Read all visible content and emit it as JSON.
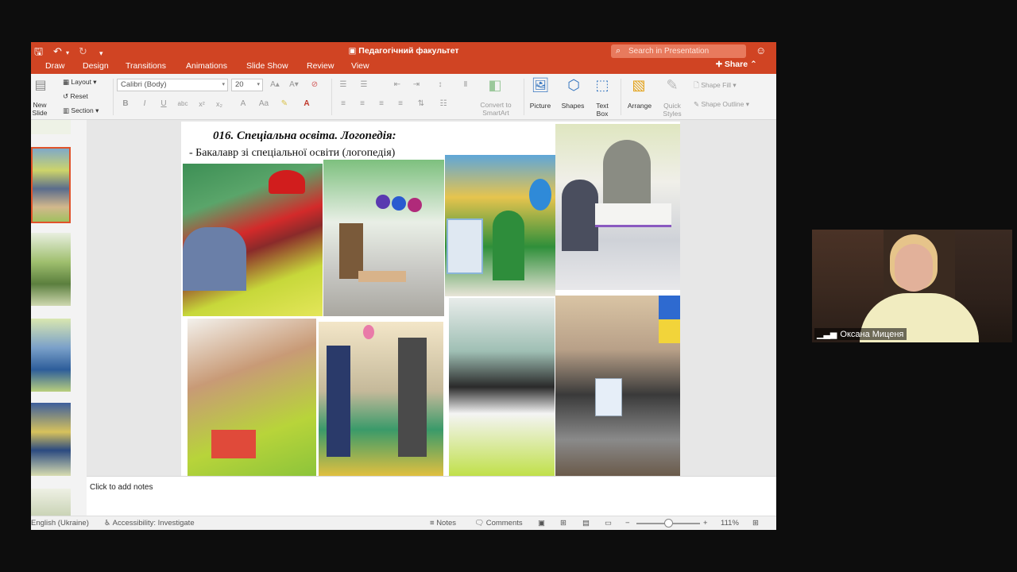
{
  "window": {
    "title": "Педагогічний факультет",
    "search_placeholder": "Search in Presentation",
    "share_label": "Share",
    "tabs": [
      "Draw",
      "Design",
      "Transitions",
      "Animations",
      "Slide Show",
      "Review",
      "View"
    ]
  },
  "ribbon": {
    "new_slide_label": "New\nSlide",
    "layout_label": "Layout",
    "reset_label": "Reset",
    "section_label": "Section",
    "font_name": "Calibri (Body)",
    "font_size": "20",
    "convert_smartart": "Convert to\nSmartArt",
    "picture_label": "Picture",
    "shapes_label": "Shapes",
    "textbox_label": "Text\nBox",
    "arrange_label": "Arrange",
    "quick_styles_label": "Quick\nStyles",
    "shape_fill_label": "Shape Fill",
    "shape_outline_label": "Shape Outline"
  },
  "slide": {
    "title": "016. Спеціальна освіта. Логопедія:",
    "subtitle": "- Бакалавр зі спеціальної освіти (логопедія)"
  },
  "notes": {
    "placeholder": "Click to add notes"
  },
  "status": {
    "language": "English (Ukraine)",
    "accessibility": "Accessibility: Investigate",
    "notes_btn": "Notes",
    "comments_btn": "Comments",
    "zoom": "111%"
  },
  "zoom_level": 111,
  "participant": {
    "name": "Оксана Миценя"
  },
  "colors": {
    "accent": "#d04423",
    "ribbon_bg": "#f3f3f3",
    "stage_bg": "#0d0d0d"
  }
}
